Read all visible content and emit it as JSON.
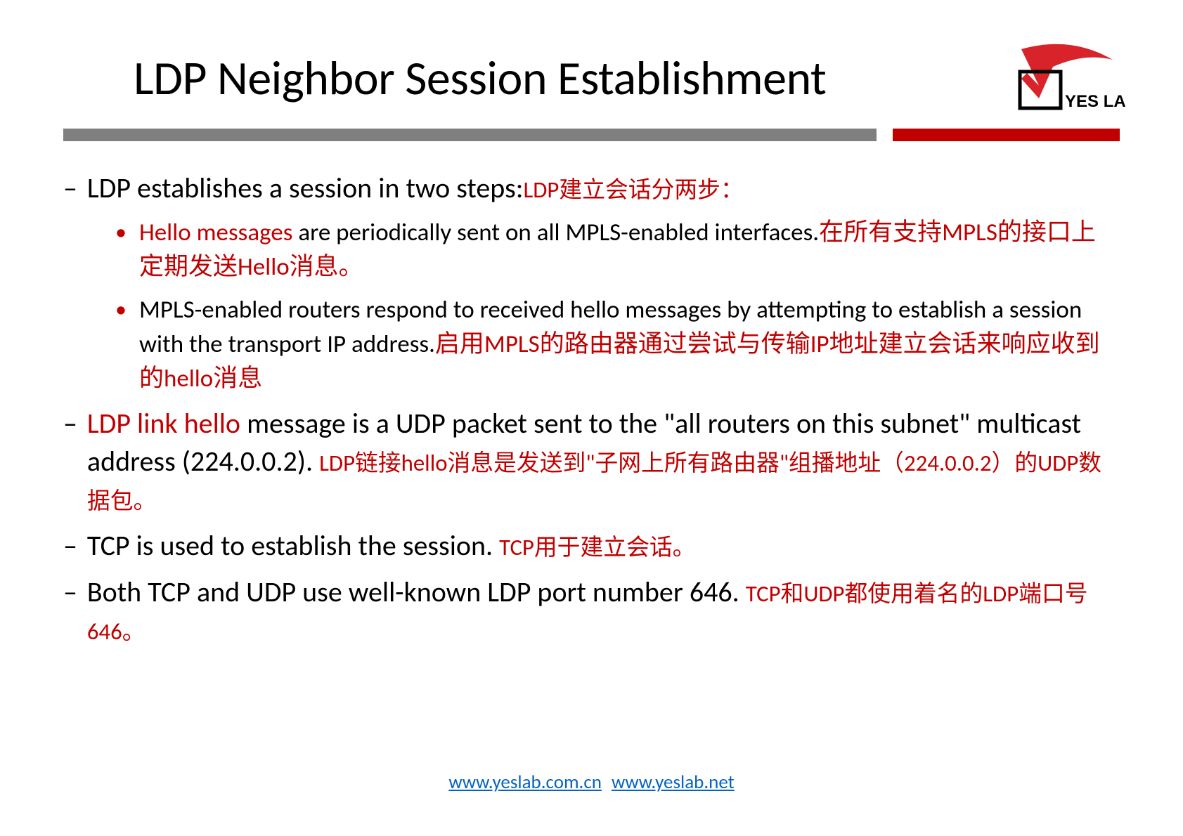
{
  "logo_text": "YES LAB",
  "title": "LDP Neighbor Session Establishment",
  "points": {
    "p1": {
      "en": "LDP establishes a session in two steps:",
      "zh": "LDP建立会话分两步："
    },
    "p1a": {
      "strong": "Hello messages",
      "rest": " are periodically sent on all MPLS-enabled  interfaces.",
      "zh": "在所有支持MPLS的接口上定期发送Hello消息。"
    },
    "p1b": {
      "en": "MPLS-enabled routers respond to received hello messages  by attempting to establish a session with the transport IP  address.",
      "zh": "启用MPLS的路由器通过尝试与传输IP地址建立会话来响应收到的hello消息"
    },
    "p2": {
      "strong": "LDP link hello",
      "rest": " message is a UDP packet sent to the \"all  routers on this subnet\" multicast address (224.0.0.2). ",
      "zh": "LDP链接hello消息是发送到\"子网上所有路由器\"组播地址（224.0.0.2）的UDP数据包。"
    },
    "p3": {
      "en": "TCP is used to establish the session. ",
      "zh": "TCP用于建立会话。"
    },
    "p4": {
      "en": "Both TCP and UDP use well-known LDP port number  646. ",
      "zh": "TCP和UDP都使用着名的LDP端口号646。"
    }
  },
  "footer": {
    "link1": "www.yeslab.com.cn",
    "link2": "www.yeslab.net"
  }
}
